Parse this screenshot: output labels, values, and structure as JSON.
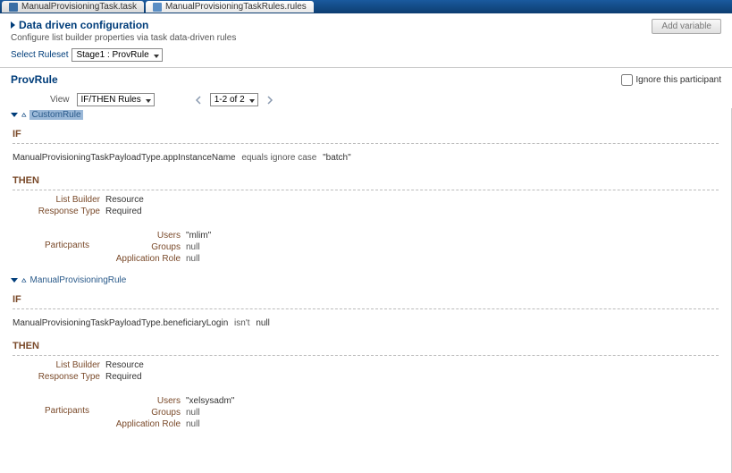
{
  "tabs": [
    {
      "label": "ManualProvisioningTask.task"
    },
    {
      "label": "ManualProvisioningTaskRules.rules"
    }
  ],
  "header": {
    "title": "Data driven configuration",
    "subtitle": "Configure list builder properties via task data-driven rules",
    "add_variable": "Add variable"
  },
  "ruleset": {
    "label": "Select Ruleset",
    "value": "Stage1 : ProvRule"
  },
  "rule": {
    "title": "ProvRule",
    "ignore_label": "Ignore this participant"
  },
  "view": {
    "label": "View",
    "mode": "IF/THEN Rules",
    "pager": "1-2 of 2"
  },
  "rules": [
    {
      "name": "CustomRule",
      "selected": true,
      "if": {
        "label": "IF",
        "lhs": "ManualProvisioningTaskPayloadType.appInstanceName",
        "op": "equals ignore case",
        "rhs": "\"batch\""
      },
      "then": {
        "label": "THEN",
        "list_builder_label": "List Builder",
        "list_builder": "Resource",
        "response_type_label": "Response Type",
        "response_type": "Required",
        "participants_label": "Particpants",
        "users_label": "Users",
        "users": "\"mlim\"",
        "groups_label": "Groups",
        "groups": "null",
        "app_role_label": "Application Role",
        "app_role": "null"
      }
    },
    {
      "name": "ManualProvisioningRule",
      "selected": false,
      "if": {
        "label": "IF",
        "lhs": "ManualProvisioningTaskPayloadType.beneficiaryLogin",
        "op": "isn't",
        "rhs": "null"
      },
      "then": {
        "label": "THEN",
        "list_builder_label": "List Builder",
        "list_builder": "Resource",
        "response_type_label": "Response Type",
        "response_type": "Required",
        "participants_label": "Particpants",
        "users_label": "Users",
        "users": "\"xelsysadm\"",
        "groups_label": "Groups",
        "groups": "null",
        "app_role_label": "Application Role",
        "app_role": "null"
      }
    }
  ]
}
